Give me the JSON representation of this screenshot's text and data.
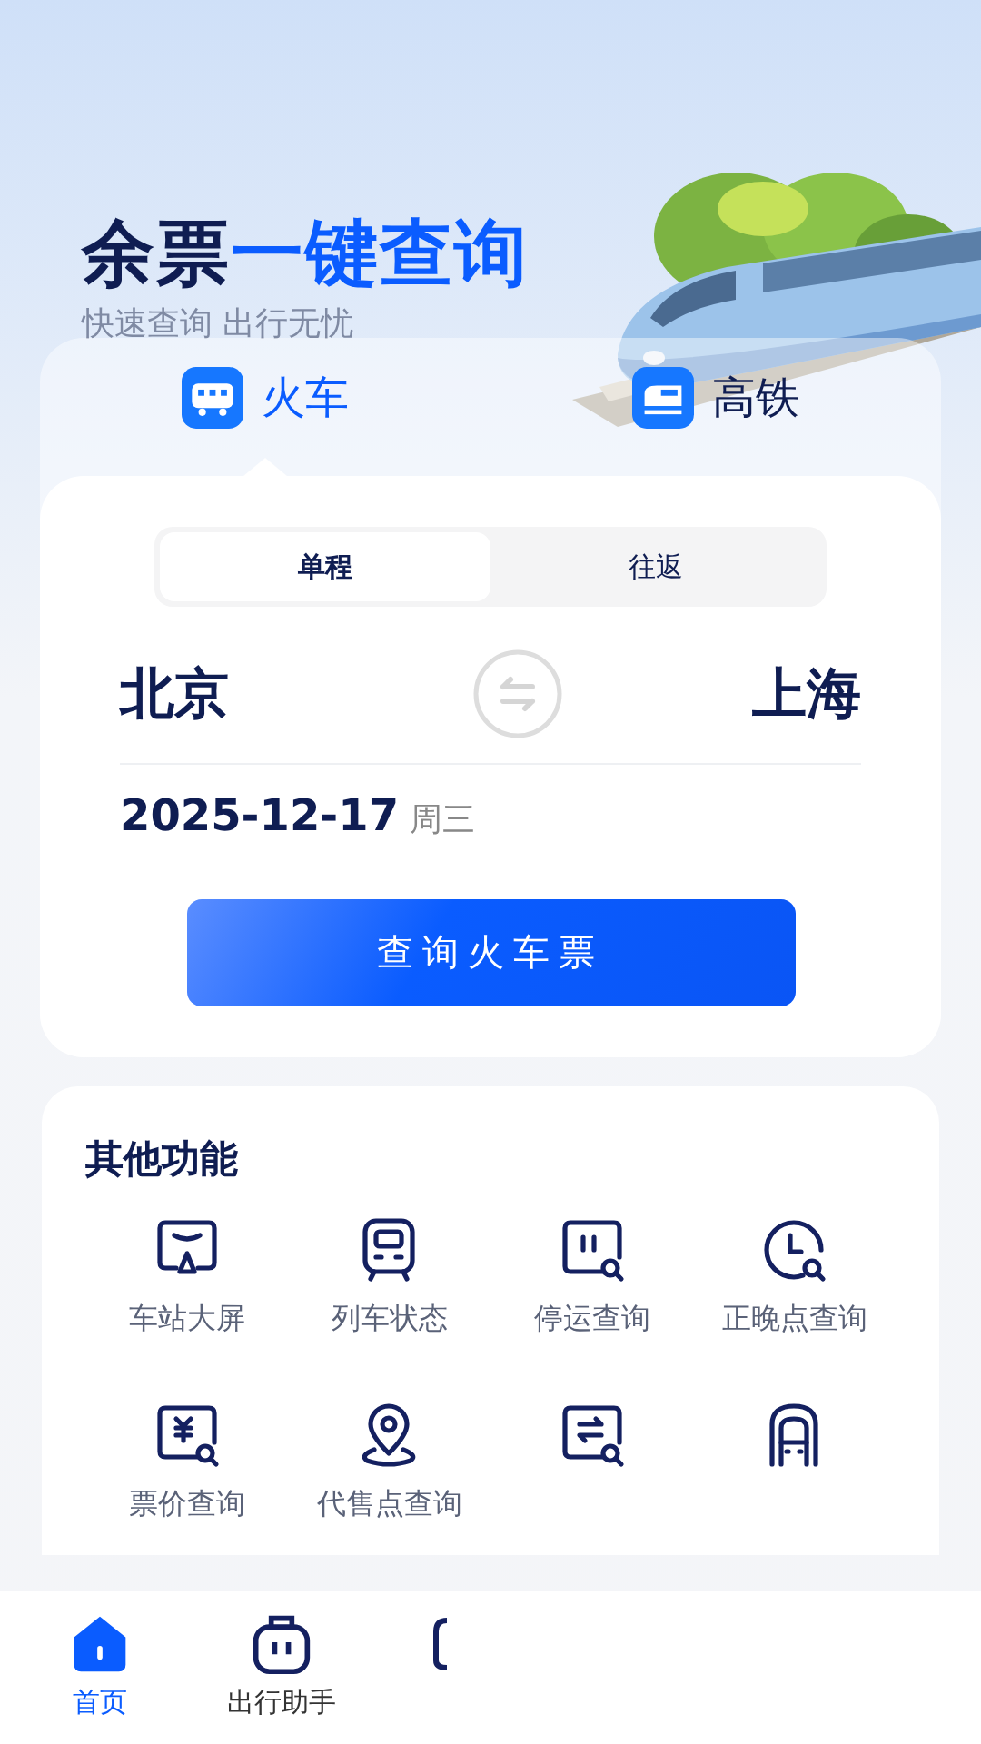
{
  "header": {
    "title_dark": "余票",
    "title_blue": "一键查询",
    "subtitle": "快速查询 出行无忧"
  },
  "mode_tabs": [
    {
      "label": "火车",
      "selected": true
    },
    {
      "label": "高铁",
      "selected": false
    }
  ],
  "trip_type": [
    {
      "label": "单程",
      "selected": true
    },
    {
      "label": "往返",
      "selected": false
    }
  ],
  "from_city": "北京",
  "to_city": "上海",
  "date": "2025-12-17",
  "weekday": "周三",
  "search_button": "查询火车票",
  "features": {
    "title": "其他功能",
    "items": [
      {
        "kind": "labeled",
        "label": "车站大屏"
      },
      {
        "kind": "labeled",
        "label": "列车状态"
      },
      {
        "kind": "labeled",
        "label": "停运查询"
      },
      {
        "kind": "labeled",
        "label": "正晚点查询"
      },
      {
        "kind": "labeled",
        "label": "票价查询"
      },
      {
        "kind": "labeled",
        "label": "代售点查询"
      },
      {
        "kind": "icon_only"
      },
      {
        "kind": "icon_only"
      }
    ]
  },
  "bottom_nav": [
    {
      "label": "首页",
      "selected": true
    },
    {
      "label": "出行助手",
      "selected": false
    },
    {
      "selected": false
    }
  ]
}
